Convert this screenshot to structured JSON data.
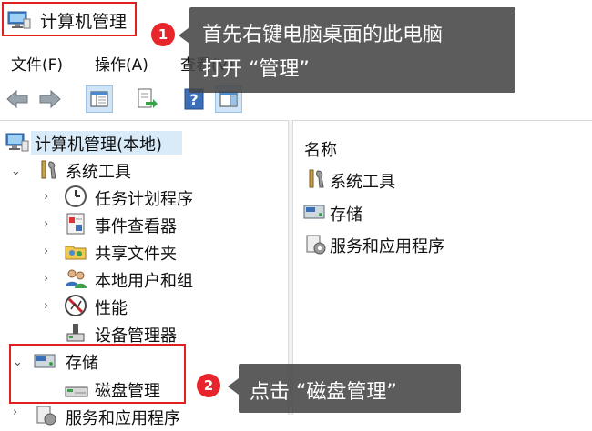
{
  "window": {
    "title": "计算机管理"
  },
  "menu": {
    "items": [
      "文件(F)",
      "操作(A)",
      "查看(V)"
    ]
  },
  "tree": {
    "root": "计算机管理(本地)",
    "system_tools": "系统工具",
    "children": [
      "任务计划程序",
      "事件查看器",
      "共享文件夹",
      "本地用户和组",
      "性能",
      "设备管理器"
    ],
    "storage": "存储",
    "disk_management": "磁盘管理",
    "services": "服务和应用程序"
  },
  "detail": {
    "column_header": "名称",
    "items": [
      "系统工具",
      "存储",
      "服务和应用程序"
    ]
  },
  "callouts": [
    {
      "number": "1",
      "line1": "首先右键电脑桌面的此电脑",
      "line2": "打开 “管理”"
    },
    {
      "number": "2",
      "text": "点击 “磁盘管理”"
    }
  ],
  "colors": {
    "highlight_red": "#e02020",
    "callout_bg": "#464646",
    "badge_red": "#e8252a",
    "selection": "#d9ebf9"
  }
}
